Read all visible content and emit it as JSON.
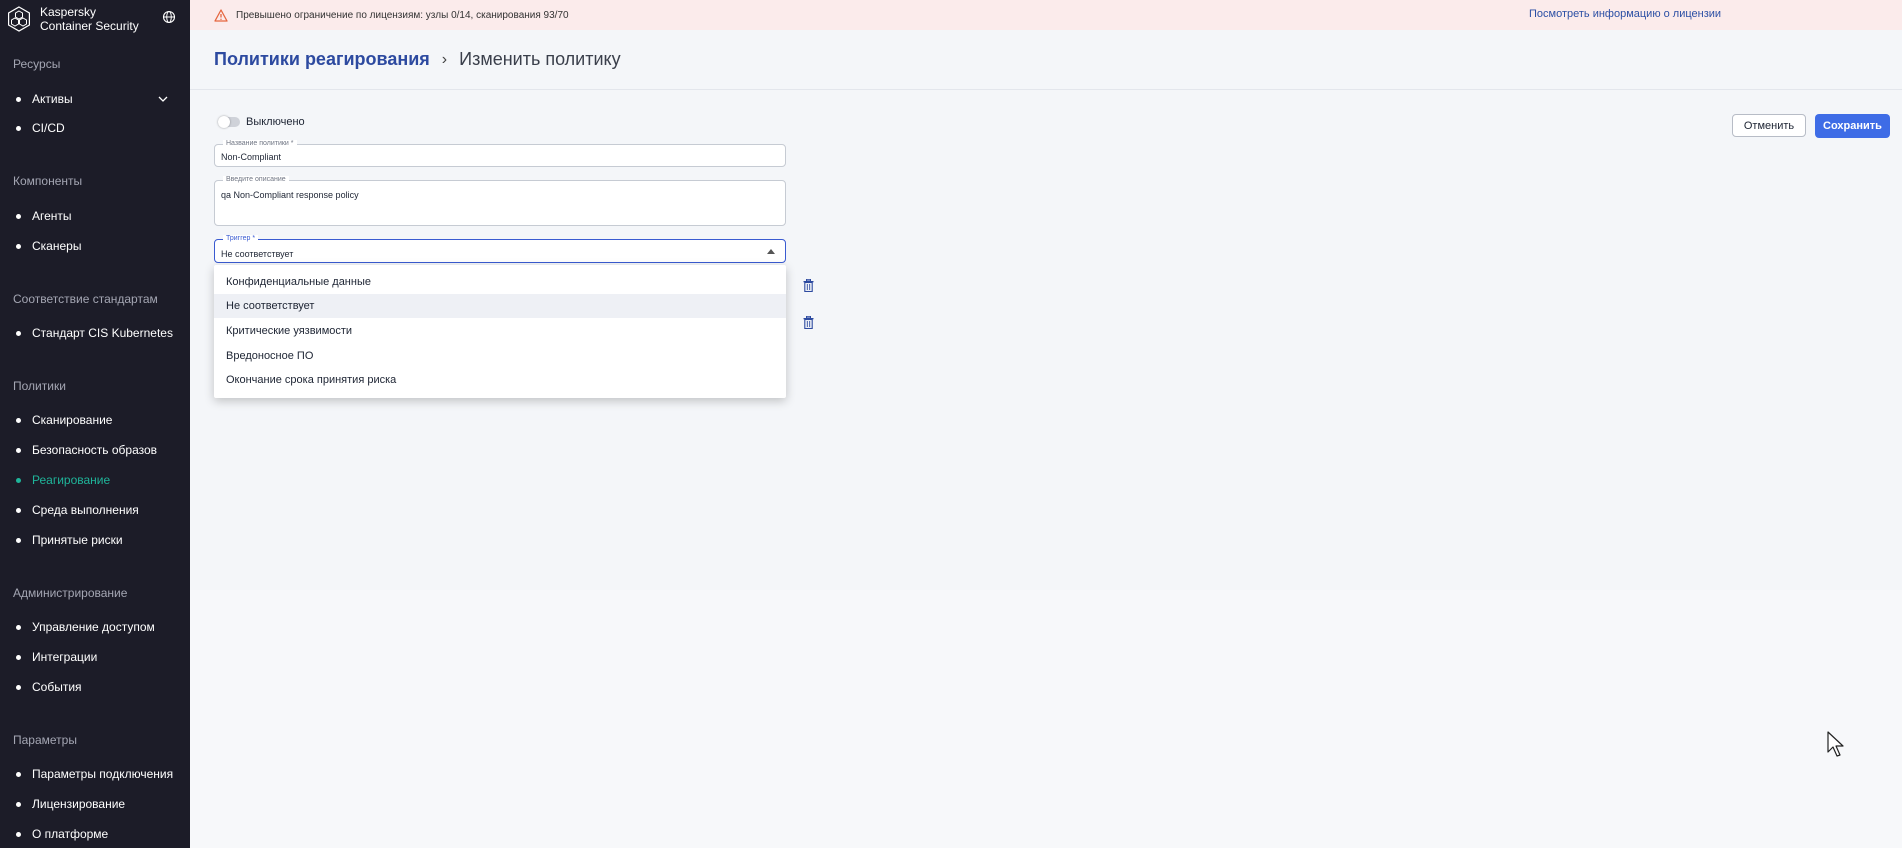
{
  "sidebar": {
    "brand": "Kaspersky Container Security",
    "brand_line1": "Kaspersky",
    "brand_line2": "Container Security",
    "sections": [
      {
        "title": "Ресурсы",
        "items": [
          {
            "label": "Активы",
            "expandable": true
          },
          {
            "label": "CI/CD"
          }
        ]
      },
      {
        "title": "Компоненты",
        "items": [
          {
            "label": "Агенты"
          },
          {
            "label": "Сканеры"
          }
        ]
      },
      {
        "title": "Соответствие стандартам",
        "items": [
          {
            "label": "Стандарт CIS Kubernetes"
          }
        ]
      },
      {
        "title": "Политики",
        "items": [
          {
            "label": "Сканирование"
          },
          {
            "label": "Безопасность образов"
          },
          {
            "label": "Реагирование",
            "active": true
          },
          {
            "label": "Среда выполнения"
          },
          {
            "label": "Принятые риски"
          }
        ]
      },
      {
        "title": "Администрирование",
        "items": [
          {
            "label": "Управление доступом"
          },
          {
            "label": "Интеграции"
          },
          {
            "label": "События"
          }
        ]
      },
      {
        "title": "Параметры",
        "items": [
          {
            "label": "Параметры подключения"
          },
          {
            "label": "Лицензирование"
          },
          {
            "label": "О платформе"
          }
        ]
      }
    ]
  },
  "banner": {
    "text": "Превышено ограничение по лицензиям: узлы 0/14, сканирования 93/70",
    "link": "Посмотреть информацию о лицензии"
  },
  "header": {
    "breadcrumb_parent": "Политики реагирования",
    "separator": "›",
    "breadcrumb_current": "Изменить политику"
  },
  "form": {
    "toggle_label": "Выключено",
    "toggle_on": false,
    "cancel_label": "Отменить",
    "save_label": "Сохранить",
    "name_label": "Название политики *",
    "name_value": "Non-Compliant",
    "description_label": "Введите описание",
    "description_value": "qa Non-Compliant response policy",
    "trigger_label": "Триггер *",
    "trigger_value": "Не соответствует",
    "trigger_options": [
      "Конфиденциальные данные",
      "Не соответствует",
      "Критические уязвимости",
      "Вредоносное ПО",
      "Окончание срока принятия риска"
    ],
    "trigger_selected_index": 1
  },
  "colors": {
    "sidebar_bg": "#1c1c28",
    "active_nav": "#1fb59a",
    "primary_button": "#3e6ce6",
    "breadcrumb_link": "#2d4aa0",
    "banner_bg": "#fbebeb",
    "warning": "#e5663f"
  }
}
